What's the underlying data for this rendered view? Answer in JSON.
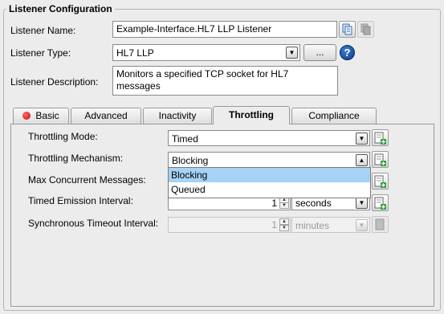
{
  "group": {
    "title": "Listener Configuration"
  },
  "listener": {
    "name_label": "Listener Name:",
    "name_value": "Example-Interface.HL7 LLP Listener",
    "type_label": "Listener Type:",
    "type_value": "HL7 LLP",
    "browse_label": "...",
    "help_glyph": "?",
    "description_label": "Listener Description:",
    "description_value": "Monitors a specified TCP socket for HL7 messages"
  },
  "tabs": [
    {
      "label": "Basic",
      "status": "error"
    },
    {
      "label": "Advanced"
    },
    {
      "label": "Inactivity"
    },
    {
      "label": "Throttling",
      "active": true
    },
    {
      "label": "Compliance"
    }
  ],
  "throttling": {
    "mode_label": "Throttling Mode:",
    "mode_value": "Timed",
    "mechanism_label": "Throttling Mechanism:",
    "mechanism_value": "Blocking",
    "mechanism_options": [
      "Blocking",
      "Queued"
    ],
    "max_concurrent_label": "Max Concurrent Messages:",
    "timed_emission_label": "Timed Emission Interval:",
    "timed_emission_value": "1",
    "timed_emission_unit": "seconds",
    "sync_timeout_label": "Synchronous Timeout Interval:",
    "sync_timeout_value": "1",
    "sync_timeout_unit": "minutes"
  },
  "colors": {
    "selection": "#a6d2f5",
    "error": "#d41a1a",
    "help": "#0b3a86"
  }
}
